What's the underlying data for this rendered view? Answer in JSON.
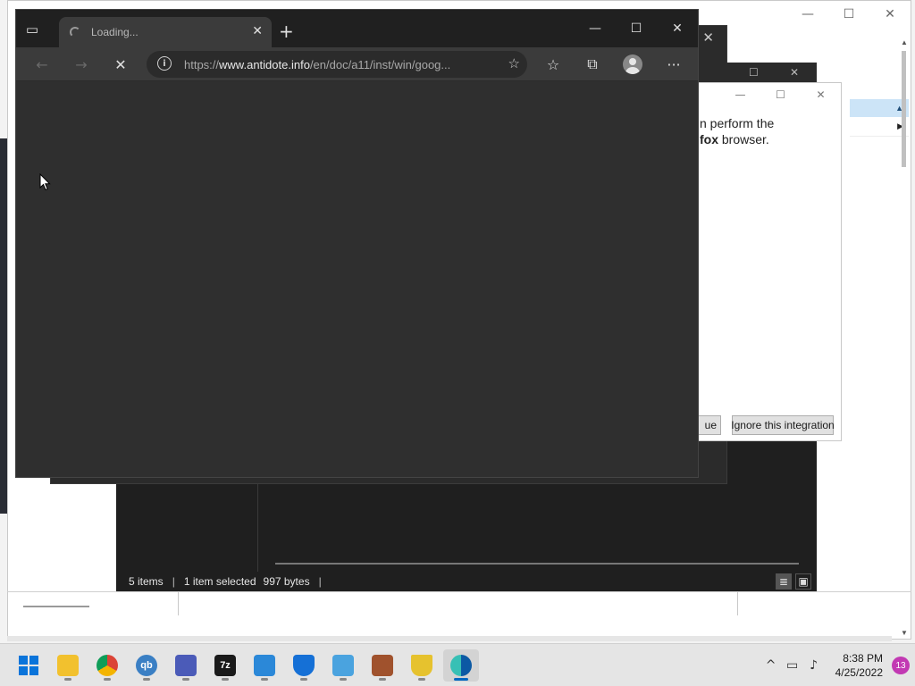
{
  "browser": {
    "tab": {
      "title": "Loading..."
    },
    "address": {
      "prefix": "https://",
      "domain": "www.antidote.info",
      "path": "/en/doc/a11/inst/win/goog..."
    }
  },
  "dialog": {
    "message_line1": "n perform the",
    "message_bold": "fox",
    "message_line2_rest": " browser.",
    "continue_label": "ue",
    "ignore_label": "Ignore this integration"
  },
  "file_manager": {
    "status": {
      "items": "5 items",
      "selected": "1 item selected",
      "size": "997 bytes"
    }
  },
  "taskbar": {
    "apps": [
      {
        "name": "file-explorer",
        "label": ""
      },
      {
        "name": "chrome",
        "label": ""
      },
      {
        "name": "qbittorrent",
        "label": "qb"
      },
      {
        "name": "remote-desktop",
        "label": ""
      },
      {
        "name": "7zip",
        "label": "7z"
      },
      {
        "name": "notepad",
        "label": ""
      },
      {
        "name": "windows-security",
        "label": ""
      },
      {
        "name": "network-tool",
        "label": ""
      },
      {
        "name": "package-tool",
        "label": ""
      },
      {
        "name": "lab-flask",
        "label": ""
      },
      {
        "name": "edge",
        "label": ""
      }
    ],
    "clock": {
      "time": "8:38 PM",
      "date": "4/25/2022"
    },
    "notification_count": "13"
  },
  "colors": {
    "browser_bg": "#2f2f2f",
    "accent": "#0067c0",
    "badge": "#c239b3"
  }
}
